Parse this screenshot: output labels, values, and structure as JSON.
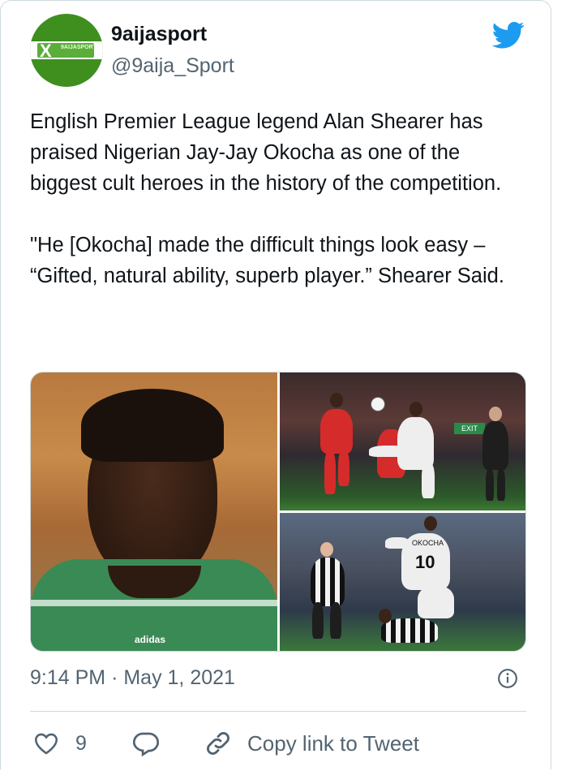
{
  "tweet": {
    "display_name": "9aijasport",
    "handle": "@9aija_Sport",
    "avatar_logo_text": "9AIJASPORT",
    "text": "English Premier League legend Alan Shearer has praised Nigerian Jay-Jay Okocha as one of the biggest cult heroes in the history of the competition.\n\n\"He [Okocha] made the difficult things look easy –  “Gifted, natural ability, superb player.” Shearer Said.",
    "time": "9:14 PM",
    "date": "May 1, 2021",
    "likes": "9",
    "copy_link_label": "Copy link to Tweet"
  },
  "media": {
    "shirt_brand": "adidas",
    "exit_sign": "EXIT",
    "jersey_name": "OKOCHA",
    "jersey_number": "10"
  },
  "colors": {
    "twitter_blue": "#1d9bf0",
    "muted_text": "#536471",
    "border": "#cfd9de"
  },
  "icons": [
    "twitter-bird-icon",
    "info-icon",
    "heart-icon",
    "reply-icon",
    "link-icon"
  ]
}
